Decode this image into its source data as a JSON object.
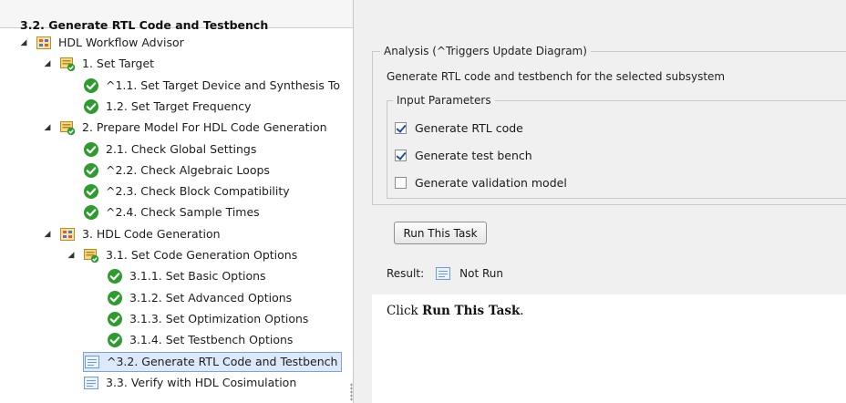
{
  "tree": {
    "items": [
      {
        "label": "HDL Workflow Advisor",
        "icon": "folder-workflow-icon",
        "expanded": true,
        "caret": true,
        "level": 0
      },
      {
        "label": "1. Set Target",
        "icon": "folder-task-icon",
        "expanded": true,
        "caret": true,
        "level": 1
      },
      {
        "label": "^1.1. Set Target Device and Synthesis To",
        "icon": "check-pass-icon",
        "caret": false,
        "level": 2
      },
      {
        "label": "1.2. Set Target Frequency",
        "icon": "check-pass-icon",
        "caret": false,
        "level": 2
      },
      {
        "label": "2. Prepare Model For HDL Code Generation",
        "icon": "folder-task-icon",
        "expanded": true,
        "caret": true,
        "level": 1
      },
      {
        "label": "2.1. Check Global Settings",
        "icon": "check-pass-icon",
        "caret": false,
        "level": 2
      },
      {
        "label": "^2.2. Check Algebraic Loops",
        "icon": "check-pass-icon",
        "caret": false,
        "level": 2
      },
      {
        "label": "^2.3. Check Block Compatibility",
        "icon": "check-pass-icon",
        "caret": false,
        "level": 2
      },
      {
        "label": "^2.4. Check Sample Times",
        "icon": "check-pass-icon",
        "caret": false,
        "level": 2
      },
      {
        "label": "3. HDL Code Generation",
        "icon": "folder-workflow-icon",
        "expanded": true,
        "caret": true,
        "level": 1
      },
      {
        "label": "3.1. Set Code Generation Options",
        "icon": "folder-task-icon",
        "expanded": true,
        "caret": true,
        "level": 2
      },
      {
        "label": "3.1.1. Set Basic Options",
        "icon": "check-pass-icon",
        "caret": false,
        "level": 3
      },
      {
        "label": "3.1.2. Set Advanced Options",
        "icon": "check-pass-icon",
        "caret": false,
        "level": 3
      },
      {
        "label": "3.1.3. Set Optimization Options",
        "icon": "check-pass-icon",
        "caret": false,
        "level": 3
      },
      {
        "label": "3.1.4. Set Testbench Options",
        "icon": "check-pass-icon",
        "caret": false,
        "level": 3
      },
      {
        "label": "^3.2. Generate RTL Code and Testbench",
        "icon": "task-notrun-icon",
        "caret": false,
        "level": 2,
        "selected": true
      },
      {
        "label": "3.3. Verify with HDL Cosimulation",
        "icon": "task-notrun-icon",
        "caret": false,
        "level": 2
      }
    ]
  },
  "panel": {
    "title": "3.2. Generate RTL Code and Testbench",
    "analysis_legend": "Analysis (^Triggers Update Diagram)",
    "description": "Generate RTL code and testbench for the selected subsystem",
    "params_legend": "Input Parameters",
    "params": [
      {
        "label": "Generate RTL code",
        "checked": true
      },
      {
        "label": "Generate test bench",
        "checked": true
      },
      {
        "label": "Generate validation model",
        "checked": false
      }
    ],
    "run_button": "Run This Task",
    "result_label": "Result:",
    "result_icon": "task-notrun-icon",
    "result_value": "Not Run",
    "output_prefix": "Click ",
    "output_bold": "Run This Task",
    "output_suffix": "."
  },
  "colors": {
    "pass_green": "#2e9b2e",
    "selection_bg": "#dbe9fb",
    "selection_border": "#7aa3d8",
    "checkbox_mark": "#1f4fa0"
  }
}
